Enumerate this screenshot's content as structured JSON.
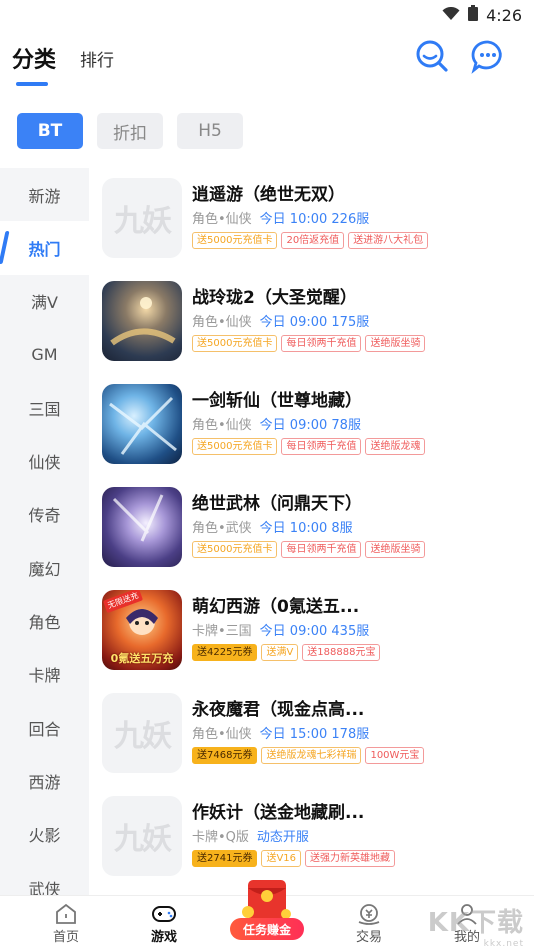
{
  "status_bar": {
    "time": "4:26"
  },
  "header": {
    "tab_main": "分类",
    "tab_rank": "排行"
  },
  "filters": [
    {
      "label": "BT",
      "active": true
    },
    {
      "label": "折扣",
      "active": false
    },
    {
      "label": "H5",
      "active": false
    }
  ],
  "sidebar": [
    {
      "label": "新游",
      "active": false
    },
    {
      "label": "热门",
      "active": true
    },
    {
      "label": "满V",
      "active": false
    },
    {
      "label": "GM",
      "active": false
    },
    {
      "label": "三国",
      "active": false
    },
    {
      "label": "仙侠",
      "active": false
    },
    {
      "label": "传奇",
      "active": false
    },
    {
      "label": "魔幻",
      "active": false
    },
    {
      "label": "角色",
      "active": false
    },
    {
      "label": "卡牌",
      "active": false
    },
    {
      "label": "回合",
      "active": false
    },
    {
      "label": "西游",
      "active": false
    },
    {
      "label": "火影",
      "active": false
    },
    {
      "label": "武侠",
      "active": false
    }
  ],
  "placeholder_logo": "九妖",
  "games": [
    {
      "title": "逍遥游（绝世无双）",
      "genre": "角色•仙侠",
      "server": "今日 10:00 226服",
      "thumb": "placeholder",
      "tags": [
        {
          "text": "送5000元充值卡",
          "style": "orange"
        },
        {
          "text": "20倍返充值",
          "style": "red"
        },
        {
          "text": "送进游八大礼包",
          "style": "red"
        }
      ]
    },
    {
      "title": "战玲珑2（大圣觉醒）",
      "genre": "角色•仙侠",
      "server": "今日 09:00 175服",
      "thumb": "art1",
      "tags": [
        {
          "text": "送5000元充值卡",
          "style": "orange"
        },
        {
          "text": "每日领两千充值",
          "style": "red"
        },
        {
          "text": "送绝版坐骑",
          "style": "red"
        }
      ]
    },
    {
      "title": "一剑斩仙（世尊地藏）",
      "genre": "角色•仙侠",
      "server": "今日 09:00 78服",
      "thumb": "art2",
      "tags": [
        {
          "text": "送5000元充值卡",
          "style": "orange"
        },
        {
          "text": "每日领两千充值",
          "style": "red"
        },
        {
          "text": "送绝版龙魂",
          "style": "red"
        }
      ]
    },
    {
      "title": "绝世武林（问鼎天下）",
      "genre": "角色•武侠",
      "server": "今日 10:00 8服",
      "thumb": "art3",
      "tags": [
        {
          "text": "送5000元充值卡",
          "style": "orange"
        },
        {
          "text": "每日领两千充值",
          "style": "red"
        },
        {
          "text": "送绝版坐骑",
          "style": "red"
        }
      ]
    },
    {
      "title": "萌幻西游（0氪送五...",
      "genre": "卡牌•三国",
      "server": "今日 09:00 435服",
      "thumb": "art4",
      "thumb_caption": "0氪送五万充",
      "thumb_badge": "无限送充",
      "tags": [
        {
          "text": "送4225元券",
          "style": "gold"
        },
        {
          "text": "送满V",
          "style": "orange"
        },
        {
          "text": "送188888元宝",
          "style": "red"
        }
      ]
    },
    {
      "title": "永夜魔君（现金点高...",
      "genre": "角色•仙侠",
      "server": "今日 15:00 178服",
      "thumb": "placeholder",
      "tags": [
        {
          "text": "送7468元券",
          "style": "gold"
        },
        {
          "text": "送绝版龙魂七彩祥瑞",
          "style": "orange"
        },
        {
          "text": "100W元宝",
          "style": "red"
        }
      ]
    },
    {
      "title": "作妖计（送金地藏刷...",
      "genre": "卡牌•Q版",
      "server": "动态开服",
      "thumb": "placeholder",
      "tags": [
        {
          "text": "送2741元券",
          "style": "gold"
        },
        {
          "text": "送V16",
          "style": "orange"
        },
        {
          "text": "送强力新英雄地藏",
          "style": "red"
        }
      ]
    }
  ],
  "bottom_nav": {
    "home": "首页",
    "games": "游戏",
    "task": "任务赚金",
    "trade": "交易",
    "mine": "我的"
  },
  "watermark": {
    "text": "KK下载",
    "domain": "kkx.net"
  },
  "colors": {
    "accent": "#3b82f6",
    "tag_orange": "#f5a623",
    "tag_red": "#ef5b5b",
    "tag_gold": "#f7b21c"
  }
}
